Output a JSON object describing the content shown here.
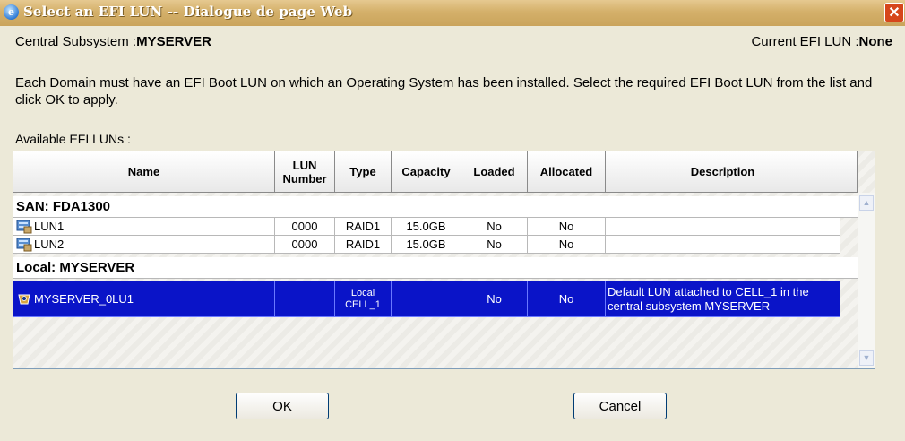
{
  "window": {
    "title": "Select an EFI LUN -- Dialogue de page Web",
    "icon": "ie-page-icon",
    "close_glyph": "✕"
  },
  "header": {
    "subsystem_label": "Central Subsystem :",
    "subsystem_value": "MYSERVER",
    "current_label": "Current EFI LUN :",
    "current_value": "None"
  },
  "instructions": "Each Domain must have an EFI Boot LUN on which an Operating System has been installed. Select the required EFI Boot LUN from the list and click OK to apply.",
  "available_label": "Available EFI LUNs :",
  "table": {
    "columns": [
      {
        "label": "Name"
      },
      {
        "label": "LUN Number"
      },
      {
        "label": "Type"
      },
      {
        "label": "Capacity"
      },
      {
        "label": "Loaded"
      },
      {
        "label": "Allocated"
      },
      {
        "label": "Description"
      }
    ],
    "groups": [
      {
        "label": "SAN: FDA1300",
        "rows": [
          {
            "name": "LUN1",
            "number": "0000",
            "type": "RAID1",
            "capacity": "15.0GB",
            "loaded": "No",
            "allocated": "No",
            "description": "",
            "icon": "disk-array-icon"
          },
          {
            "name": "LUN2",
            "number": "0000",
            "type": "RAID1",
            "capacity": "15.0GB",
            "loaded": "No",
            "allocated": "No",
            "description": "",
            "icon": "disk-array-icon"
          }
        ]
      },
      {
        "label": "Local: MYSERVER",
        "rows": [
          {
            "name": "MYSERVER_0LU1",
            "number": "",
            "type_line1": "Local",
            "type_line2": "CELL_1",
            "capacity": "",
            "loaded": "No",
            "allocated": "No",
            "description": "Default LUN attached to CELL_1 in the central subsystem MYSERVER",
            "icon": "local-disk-icon",
            "selected": true
          }
        ]
      }
    ]
  },
  "buttons": {
    "ok": "OK",
    "cancel": "Cancel"
  },
  "colors": {
    "selection": "#0a14c8",
    "titlebar": "#d4b06a",
    "dialog_bg": "#ece9d8"
  }
}
